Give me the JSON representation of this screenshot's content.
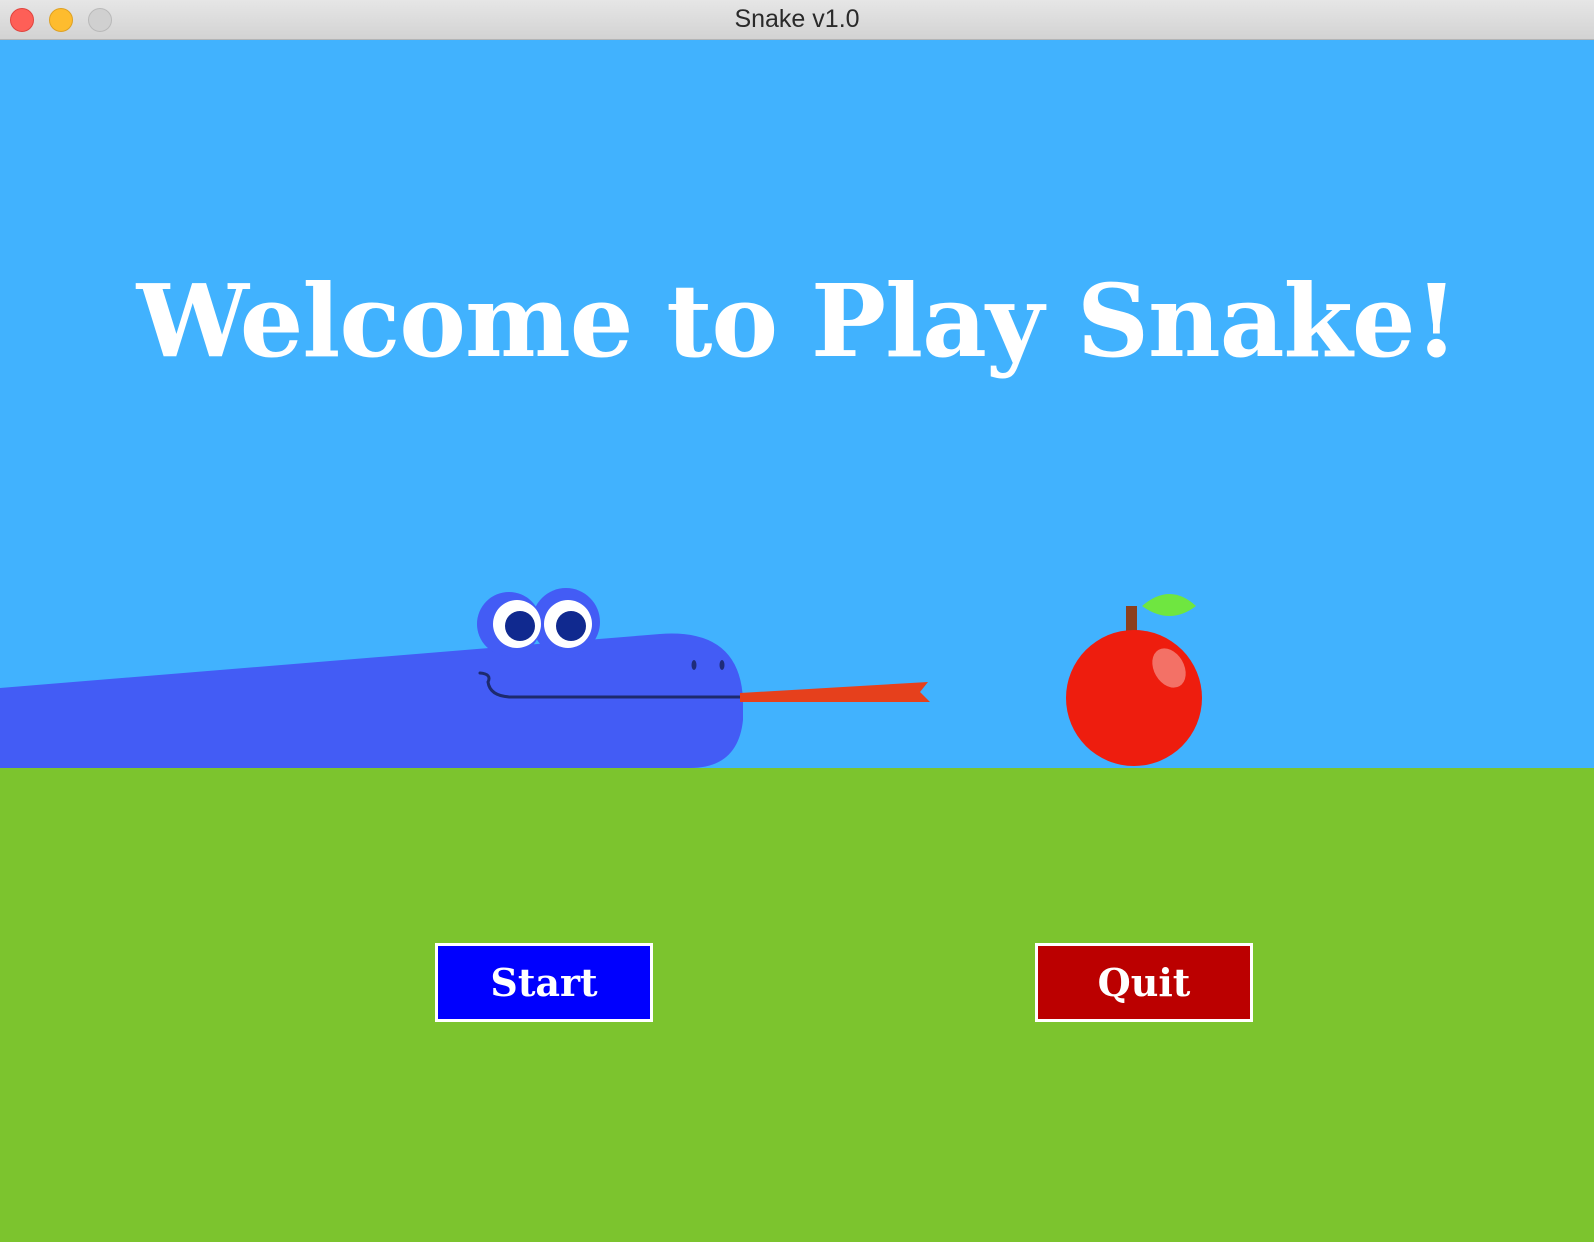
{
  "window": {
    "title": "Snake v1.0"
  },
  "menu": {
    "headline": "Welcome to Play Snake!",
    "start_label": "Start",
    "quit_label": "Quit"
  },
  "colors": {
    "sky": "#41b2fe",
    "ground": "#7cc42e",
    "snake": "#435cf5",
    "tongue": "#e6401c",
    "apple": "#ee1d0e",
    "leaf": "#6fe640",
    "start_button": "#0000fe",
    "quit_button": "#bb0000"
  },
  "icons": {
    "snake": "snake-icon",
    "apple": "apple-icon"
  }
}
